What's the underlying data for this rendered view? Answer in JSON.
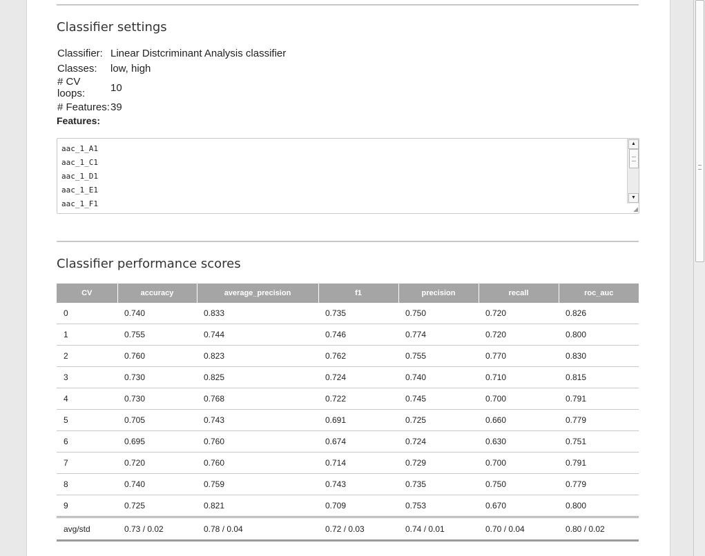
{
  "settings_section": {
    "title": "Classifier settings",
    "rows": [
      {
        "key": "Classifier:",
        "value": "Linear Distcriminant Analysis classifier"
      },
      {
        "key": "Classes:",
        "value": "low, high"
      },
      {
        "key": "# CV loops:",
        "value": "10"
      },
      {
        "key": "# Features:",
        "value": "39"
      }
    ],
    "features_label": "Features:",
    "features": [
      "aac_1_A1",
      "aac_1_C1",
      "aac_1_D1",
      "aac_1_E1",
      "aac_1_F1"
    ],
    "icons": {
      "scroll_up": "arrow-up-icon",
      "scroll_down": "arrow-down-icon",
      "resize": "resize-grip-icon"
    }
  },
  "scores_section": {
    "title": "Classifier performance scores",
    "columns": [
      "CV",
      "accuracy",
      "average_precision",
      "f1",
      "precision",
      "recall",
      "roc_auc"
    ],
    "rows": [
      [
        "0",
        "0.740",
        "0.833",
        "0.735",
        "0.750",
        "0.720",
        "0.826"
      ],
      [
        "1",
        "0.755",
        "0.744",
        "0.746",
        "0.774",
        "0.720",
        "0.800"
      ],
      [
        "2",
        "0.760",
        "0.823",
        "0.762",
        "0.755",
        "0.770",
        "0.830"
      ],
      [
        "3",
        "0.730",
        "0.825",
        "0.724",
        "0.740",
        "0.710",
        "0.815"
      ],
      [
        "4",
        "0.730",
        "0.768",
        "0.722",
        "0.745",
        "0.700",
        "0.791"
      ],
      [
        "5",
        "0.705",
        "0.743",
        "0.691",
        "0.725",
        "0.660",
        "0.779"
      ],
      [
        "6",
        "0.695",
        "0.760",
        "0.674",
        "0.724",
        "0.630",
        "0.751"
      ],
      [
        "7",
        "0.720",
        "0.760",
        "0.714",
        "0.729",
        "0.700",
        "0.791"
      ],
      [
        "8",
        "0.740",
        "0.759",
        "0.743",
        "0.735",
        "0.750",
        "0.779"
      ],
      [
        "9",
        "0.725",
        "0.821",
        "0.709",
        "0.753",
        "0.670",
        "0.800"
      ]
    ],
    "footer": [
      "avg/std",
      "0.73 / 0.02",
      "0.78 / 0.04",
      "0.72 / 0.03",
      "0.74 / 0.01",
      "0.70 / 0.04",
      "0.80 / 0.02"
    ]
  },
  "colors": {
    "header_bg": "#a5a5a5",
    "rule": "#c8c8c8"
  }
}
